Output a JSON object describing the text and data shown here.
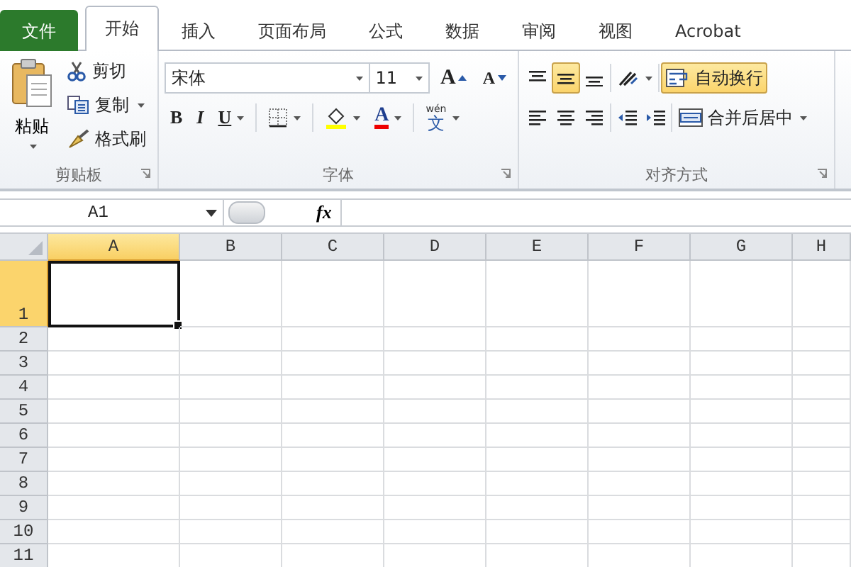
{
  "tabs": [
    {
      "label": "文件",
      "kind": "file",
      "selected": false
    },
    {
      "label": "开始",
      "kind": "tab",
      "selected": true
    },
    {
      "label": "插入",
      "kind": "tab",
      "selected": false
    },
    {
      "label": "页面布局",
      "kind": "tab",
      "selected": false
    },
    {
      "label": "公式",
      "kind": "tab",
      "selected": false
    },
    {
      "label": "数据",
      "kind": "tab",
      "selected": false
    },
    {
      "label": "审阅",
      "kind": "tab",
      "selected": false
    },
    {
      "label": "视图",
      "kind": "tab",
      "selected": false
    },
    {
      "label": "Acrobat",
      "kind": "tab",
      "selected": false
    }
  ],
  "ribbon": {
    "groups": [
      {
        "kind": "clipboard",
        "label": "剪贴板",
        "paste": {
          "label": "粘贴"
        },
        "items": [
          {
            "kind": "cut",
            "label": "剪切"
          },
          {
            "kind": "copy",
            "label": "复制",
            "dropdown": true
          },
          {
            "kind": "painter",
            "label": "格式刷"
          }
        ]
      },
      {
        "kind": "font",
        "label": "字体",
        "font_name": "宋体",
        "font_size": "11",
        "size_tools": [
          {
            "kind": "grow",
            "label": "A"
          },
          {
            "kind": "shrink",
            "label": "A"
          }
        ],
        "format_tools": [
          {
            "kind": "bold",
            "label": "B"
          },
          {
            "kind": "italic",
            "label": "I"
          },
          {
            "kind": "underline",
            "label": "U",
            "dropdown": true
          },
          {
            "kind": "borders",
            "dropdown": true
          },
          {
            "kind": "fill",
            "dropdown": true
          },
          {
            "kind": "font-color",
            "label": "A",
            "dropdown": true
          },
          {
            "kind": "phonetic",
            "label": "文",
            "sub": "wén",
            "dropdown": true
          }
        ]
      },
      {
        "kind": "alignment",
        "label": "对齐方式",
        "row_1": [
          {
            "kind": "align-top",
            "selected": false
          },
          {
            "kind": "align-middle",
            "selected": true
          },
          {
            "kind": "align-bottom",
            "selected": false
          },
          {
            "kind": "orientation",
            "dropdown": true
          }
        ],
        "wide_1": {
          "kind": "wrap",
          "label": "自动换行",
          "selected": true
        },
        "row_2": [
          {
            "kind": "align-left",
            "selected": false
          },
          {
            "kind": "align-center",
            "selected": false
          },
          {
            "kind": "align-right",
            "selected": false
          },
          {
            "kind": "outdent"
          },
          {
            "kind": "indent"
          }
        ],
        "wide_2": {
          "kind": "merge",
          "label": "合并后居中",
          "dropdown": true,
          "selected": false
        }
      }
    ]
  },
  "formula_bar": {
    "name_box": "A1",
    "function_label": "fx"
  },
  "sheet": {
    "columns": [
      {
        "label": "A",
        "selected": true
      },
      {
        "label": "B",
        "selected": false
      },
      {
        "label": "C",
        "selected": false
      },
      {
        "label": "D",
        "selected": false
      },
      {
        "label": "E",
        "selected": false
      },
      {
        "label": "F",
        "selected": false
      },
      {
        "label": "G",
        "selected": false
      },
      {
        "label": "H",
        "selected": false
      }
    ],
    "rows": [
      {
        "label": "1",
        "selected": true
      },
      {
        "label": "2",
        "selected": false
      },
      {
        "label": "3",
        "selected": false
      },
      {
        "label": "4",
        "selected": false
      },
      {
        "label": "5",
        "selected": false
      },
      {
        "label": "6",
        "selected": false
      },
      {
        "label": "7",
        "selected": false
      },
      {
        "label": "8",
        "selected": false
      },
      {
        "label": "9",
        "selected": false
      },
      {
        "label": "10",
        "selected": false
      },
      {
        "label": "11",
        "selected": false
      }
    ]
  }
}
